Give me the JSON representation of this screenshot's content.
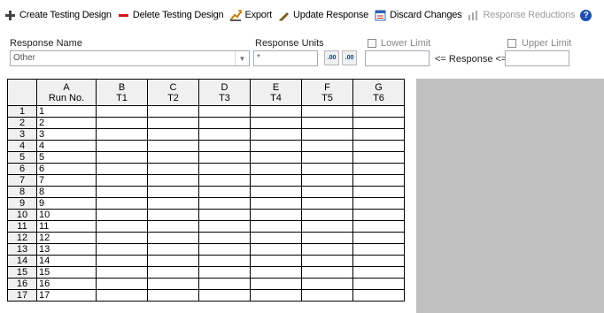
{
  "toolbar": {
    "create": "Create Testing Design",
    "delete": "Delete Testing Design",
    "export": "Export",
    "update": "Update Response",
    "discard": "Discard Changes",
    "reductions": "Response Reductions",
    "help": "?"
  },
  "form": {
    "response_name_label": "Response Name",
    "response_name_value": "Other",
    "response_units_label": "Response Units",
    "response_units_value": "*",
    "lower_limit_label": "Lower Limit",
    "upper_limit_label": "Upper Limit",
    "between_label": "<= Response <=",
    "inc_button": ".00",
    "dec_button": ".00"
  },
  "grid": {
    "columns": [
      {
        "letter": "A",
        "name": "Run No."
      },
      {
        "letter": "B",
        "name": "T1"
      },
      {
        "letter": "C",
        "name": "T2"
      },
      {
        "letter": "D",
        "name": "T3"
      },
      {
        "letter": "E",
        "name": "T4"
      },
      {
        "letter": "F",
        "name": "T5"
      },
      {
        "letter": "G",
        "name": "T6"
      }
    ],
    "rows": [
      {
        "num": "1",
        "run": "1"
      },
      {
        "num": "2",
        "run": "2"
      },
      {
        "num": "3",
        "run": "3"
      },
      {
        "num": "4",
        "run": "4"
      },
      {
        "num": "5",
        "run": "5"
      },
      {
        "num": "6",
        "run": "6"
      },
      {
        "num": "7",
        "run": "7"
      },
      {
        "num": "8",
        "run": "8"
      },
      {
        "num": "9",
        "run": "9"
      },
      {
        "num": "10",
        "run": "10"
      },
      {
        "num": "11",
        "run": "11"
      },
      {
        "num": "12",
        "run": "12"
      },
      {
        "num": "13",
        "run": "13"
      },
      {
        "num": "14",
        "run": "14"
      },
      {
        "num": "15",
        "run": "15"
      },
      {
        "num": "16",
        "run": "16"
      },
      {
        "num": "17",
        "run": "17"
      }
    ]
  }
}
